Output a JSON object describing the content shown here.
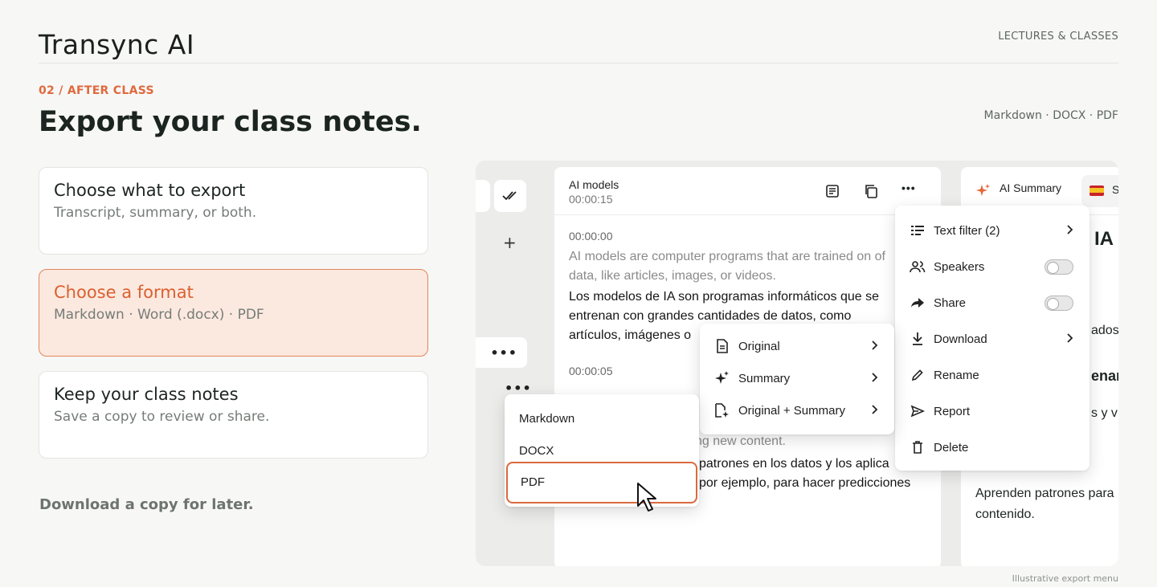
{
  "brand": "Transync AI",
  "top_link": "LECTURES & CLASSES",
  "eyebrow": "02 / AFTER CLASS",
  "headline": "Export your class notes.",
  "formats_line": "Markdown · DOCX · PDF",
  "steps": [
    {
      "title": "Choose what to export",
      "subtitle": "Transcript, summary, or both."
    },
    {
      "title": "Choose a format",
      "subtitle": "Markdown · Word (.docx) · PDF"
    },
    {
      "title": "Keep your class notes",
      "subtitle": "Save a copy to review or share."
    }
  ],
  "footnote": "Download a copy for later.",
  "transcript": {
    "name": "AI models",
    "duration": "00:00:15",
    "segments": [
      {
        "time": "00:00:00",
        "original": "AI models are computer programs that are trained on of data, like articles, images, or videos.",
        "translated_lines": [
          "Los modelos de IA son programas informáticos que se",
          "entrenan con grandes cantidades de datos, como",
          "artículos, imágenes o"
        ]
      },
      {
        "time": "00:00:05",
        "partial_original": "ting new content.",
        "partial_lines": [
          "patrones en los datos y los aplica",
          "por ejemplo, para hacer predicciones"
        ]
      }
    ]
  },
  "summary_panel": {
    "tab_label": "AI Summary",
    "chip_letter": "S",
    "heading_fragment": "IA",
    "fragments": [
      "ados",
      "enar",
      "s y v"
    ],
    "body_lines": [
      "Aprenden patrones para",
      "contenido."
    ]
  },
  "more_menu": [
    {
      "label": "Text filter (2)",
      "icon": "filter-icon",
      "control": "chevron"
    },
    {
      "label": "Speakers",
      "icon": "speakers-icon",
      "control": "toggle"
    },
    {
      "label": "Share",
      "icon": "share-icon",
      "control": "toggle"
    },
    {
      "label": "Download",
      "icon": "download-icon",
      "control": "chevron"
    },
    {
      "label": "Rename",
      "icon": "pencil-icon",
      "control": "none"
    },
    {
      "label": "Report",
      "icon": "send-icon",
      "control": "none"
    },
    {
      "label": "Delete",
      "icon": "trash-icon",
      "control": "none"
    }
  ],
  "content_menu": [
    {
      "label": "Original",
      "icon": "document-icon"
    },
    {
      "label": "Summary",
      "icon": "sparkle-icon"
    },
    {
      "label": "Original + Summary",
      "icon": "document-sparkle-icon"
    }
  ],
  "format_menu": {
    "items": [
      "Markdown",
      "DOCX",
      "PDF"
    ],
    "selected": "PDF"
  },
  "toggles": {
    "speakers": false,
    "share": false
  },
  "colors": {
    "accent": "#df6a3d",
    "active_card_bg": "#fbe9df"
  },
  "caption": "Illustrative export menu"
}
